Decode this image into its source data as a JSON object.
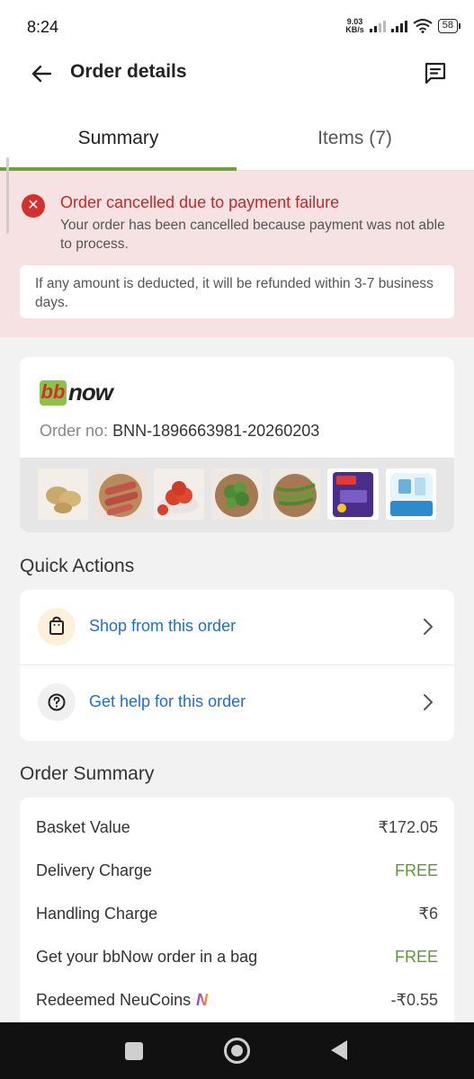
{
  "status_bar": {
    "time": "8:24",
    "net_speed_value": "9.03",
    "net_speed_unit": "KB/s",
    "battery": "58"
  },
  "header": {
    "title": "Order details",
    "back_icon": "back-arrow-icon",
    "chat_icon": "chat-message-icon"
  },
  "tabs": [
    {
      "label": "Summary",
      "active": true
    },
    {
      "label": "Items (7)",
      "active": false
    }
  ],
  "alert": {
    "title": "Order cancelled due to payment failure",
    "description": "Your order has been cancelled because payment was not able to process.",
    "refund_note": "If any amount is deducted, it will be refunded within 3-7 business days.",
    "color": "#c62828"
  },
  "store": {
    "logo_bb": "bb",
    "logo_now": "now",
    "order_no_label": "Order no:",
    "order_no": "BNN-1896663981-20260203",
    "items": [
      {
        "icon": "potato-thumbnail"
      },
      {
        "icon": "sweet-potato-thumbnail"
      },
      {
        "icon": "tomato-thumbnail"
      },
      {
        "icon": "coriander-thumbnail"
      },
      {
        "icon": "green-chilli-thumbnail"
      },
      {
        "icon": "harpic-toilet-cleaner-thumbnail"
      },
      {
        "icon": "milk-packet-thumbnail"
      }
    ]
  },
  "quick_actions": {
    "title": "Quick Actions",
    "items": [
      {
        "label": "Shop from this order",
        "icon": "shopping-bag-icon"
      },
      {
        "label": "Get help for this order",
        "icon": "help-question-icon"
      }
    ]
  },
  "order_summary": {
    "title": "Order Summary",
    "rows": [
      {
        "label": "Basket Value",
        "value": "₹172.05",
        "free": false
      },
      {
        "label": "Delivery Charge",
        "value": "FREE",
        "free": true
      },
      {
        "label": "Handling Charge",
        "value": "₹6",
        "free": false
      },
      {
        "label": "Get your bbNow order in a bag",
        "value": "FREE",
        "free": true
      },
      {
        "label": "Redeemed NeuCoins",
        "value": "-₹0.55",
        "free": false
      }
    ],
    "accent_green": "#5b9a2f"
  }
}
